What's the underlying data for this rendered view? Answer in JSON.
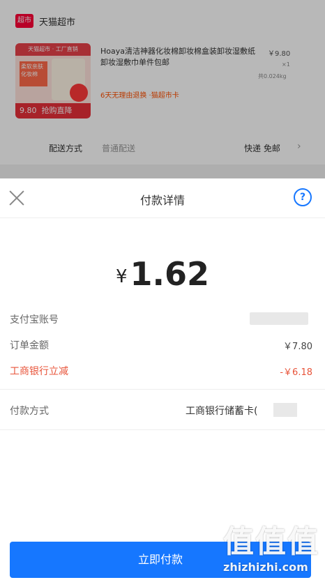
{
  "background": {
    "store_logo": "超市",
    "store_name": "天猫超市",
    "product": {
      "thumb_header": "天猫超市 · 工厂直销",
      "thumb_tag": "柔软亲肤化妆棉",
      "thumb_price": "9.80",
      "thumb_button": "抢购直降",
      "title": "Hoaya清洁神器化妆棉卸妆棉盒装卸妆湿敷纸卸妆湿敷巾单件包邮",
      "price": "￥9.80",
      "qty": "×1",
      "spec": "共0.024kg",
      "promo": "6天无理由退换 ·猫超市卡"
    },
    "shipping": {
      "label": "配送方式",
      "mode": "普通配送",
      "value": "快递 免邮",
      "arrow": "›"
    }
  },
  "sheet": {
    "title": "付款详情",
    "help_label": "?",
    "amount": {
      "currency": "¥",
      "value": "1.62"
    },
    "rows": [
      {
        "label": "支付宝账号",
        "value": ""
      },
      {
        "label": "订单金额",
        "value": "￥7.80"
      },
      {
        "label": "工商银行立减",
        "value": "-￥6.18"
      }
    ],
    "payment_method": {
      "label": "付款方式",
      "value": "工商银行储蓄卡("
    },
    "pay_button": "立即付款"
  },
  "watermark": {
    "glyphs": "值值值",
    "text": "zhizhizhi.com"
  },
  "colors": {
    "accent": "#1677ff",
    "discount": "#e8543a",
    "overlay": "rgba(0,0,0,0.28)"
  }
}
